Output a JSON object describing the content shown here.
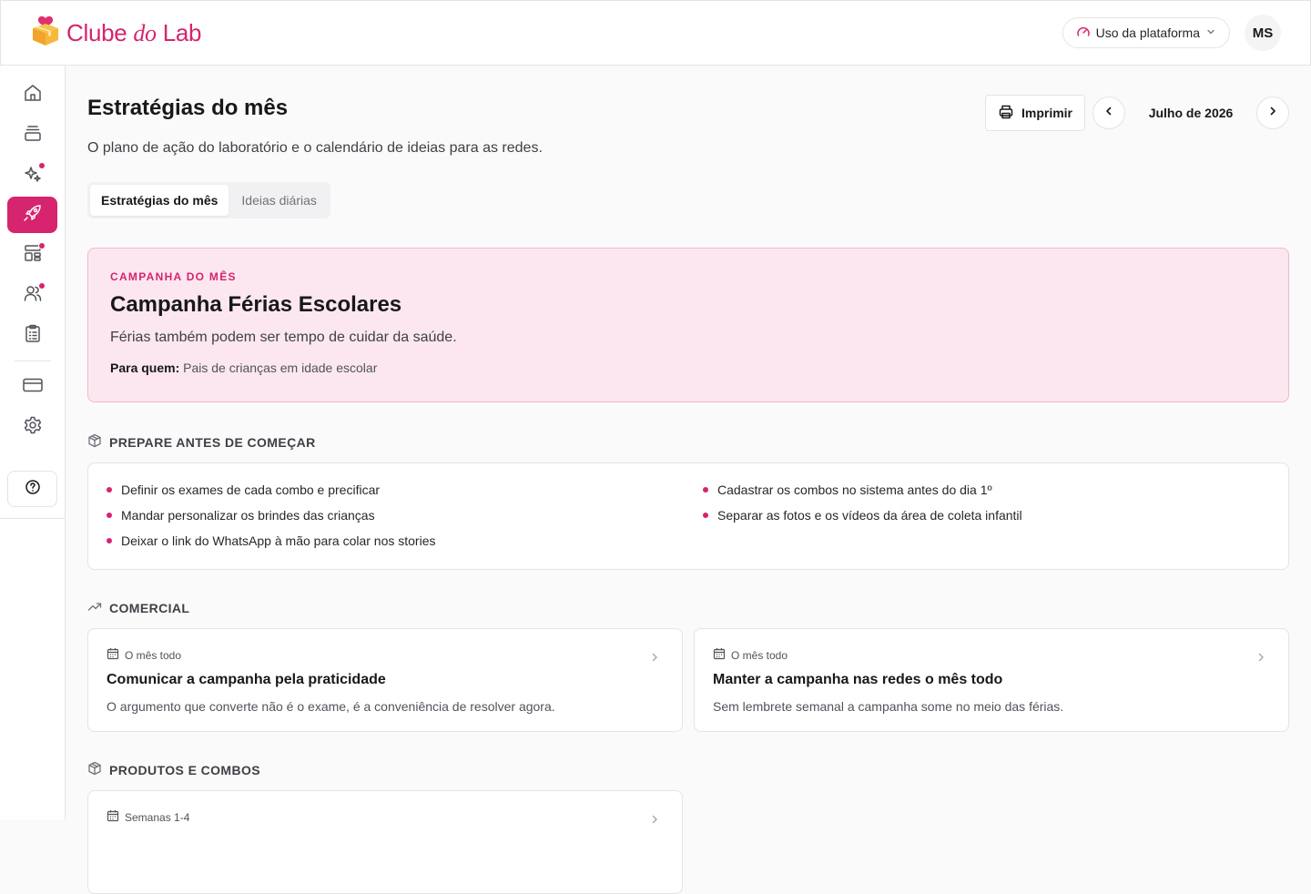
{
  "brand": {
    "name_part1": "Clube ",
    "name_part2": "do",
    "name_part3": " Lab",
    "color": "#d6246e"
  },
  "topbar": {
    "usage_label": "Uso da plataforma",
    "avatar_initials": "MS"
  },
  "sidebar": {
    "items": [
      {
        "icon": "home-icon",
        "active": false,
        "badge": false
      },
      {
        "icon": "layers-icon",
        "active": false,
        "badge": false
      },
      {
        "icon": "sparkles-icon",
        "active": false,
        "badge": true
      },
      {
        "icon": "rocket-icon",
        "active": true,
        "badge": false
      },
      {
        "icon": "layout-icon",
        "active": false,
        "badge": true
      },
      {
        "icon": "users-icon",
        "active": false,
        "badge": true
      },
      {
        "icon": "clipboard-icon",
        "active": false,
        "badge": false
      },
      {
        "icon": "credit-card-icon",
        "active": false,
        "badge": false
      },
      {
        "icon": "gear-icon",
        "active": false,
        "badge": false
      }
    ],
    "help_icon": "help-circle-icon"
  },
  "page": {
    "title": "Estratégias do mês",
    "subtitle": "O plano de ação do laboratório e o calendário de ideias para as redes.",
    "print_label": "Imprimir",
    "month_label": "Julho de 2026",
    "tabs": [
      {
        "label": "Estratégias do mês",
        "active": true
      },
      {
        "label": "Ideias diárias",
        "active": false
      }
    ]
  },
  "campaign": {
    "kicker": "CAMPANHA DO MÊS",
    "title": "Campanha Férias Escolares",
    "tagline": "Férias também podem ser tempo de cuidar da saúde.",
    "audience_label": "Para quem:",
    "audience_value": " Pais de crianças em idade escolar"
  },
  "prepare": {
    "heading": "PREPARE ANTES DE COMEÇAR",
    "left": [
      "Definir os exames de cada combo e precificar",
      "Mandar personalizar os brindes das crianças",
      "Deixar o link do WhatsApp à mão para colar nos stories"
    ],
    "right": [
      "Cadastrar os combos no sistema antes do dia 1º",
      "Separar as fotos e os vídeos da área de coleta infantil"
    ]
  },
  "comercial": {
    "heading": "COMERCIAL",
    "cards": [
      {
        "meta": "O mês todo",
        "title": "Comunicar a campanha pela praticidade",
        "desc": "O argumento que converte não é o exame, é a conveniência de resolver agora."
      },
      {
        "meta": "O mês todo",
        "title": "Manter a campanha nas redes o mês todo",
        "desc": "Sem lembrete semanal a campanha some no meio das férias."
      }
    ]
  },
  "produtos": {
    "heading": "PRODUTOS E COMBOS",
    "cards": [
      {
        "meta": "Semanas 1-4"
      }
    ]
  }
}
